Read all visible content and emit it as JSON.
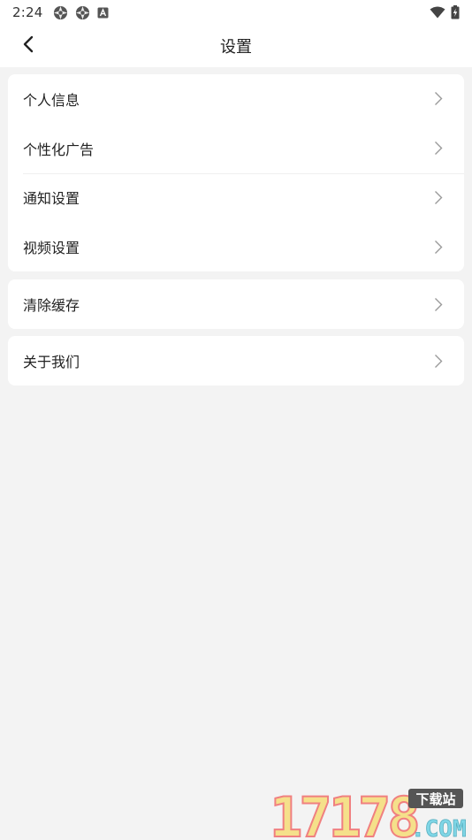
{
  "status_bar": {
    "time": "2:24",
    "left_icons": [
      "aperture-icon",
      "aperture-icon",
      "keyboard-a-icon"
    ],
    "right_icons": [
      "wifi-icon",
      "battery-charging-icon"
    ]
  },
  "header": {
    "title": "设置",
    "back_icon": "chevron-left-icon"
  },
  "groups": [
    {
      "items": [
        {
          "label": "个人信息",
          "icon": "chevron-right-icon"
        },
        {
          "label": "个性化广告",
          "icon": "chevron-right-icon"
        },
        {
          "label": "通知设置",
          "icon": "chevron-right-icon"
        },
        {
          "label": "视频设置",
          "icon": "chevron-right-icon"
        }
      ]
    },
    {
      "items": [
        {
          "label": "清除缓存",
          "icon": "chevron-right-icon"
        }
      ]
    },
    {
      "items": [
        {
          "label": "关于我们",
          "icon": "chevron-right-icon"
        }
      ]
    }
  ],
  "watermark": {
    "digits": "17178",
    "badge": "下载站",
    "suffix": ".COM"
  },
  "colors": {
    "background": "#f3f3f3",
    "card": "#ffffff",
    "text": "#222222",
    "chevron": "#9a9a9a",
    "watermark_red": "#f08080",
    "watermark_yellow": "#f5e08a",
    "watermark_cyan": "#7fd6e6",
    "watermark_badge": "#555555"
  }
}
